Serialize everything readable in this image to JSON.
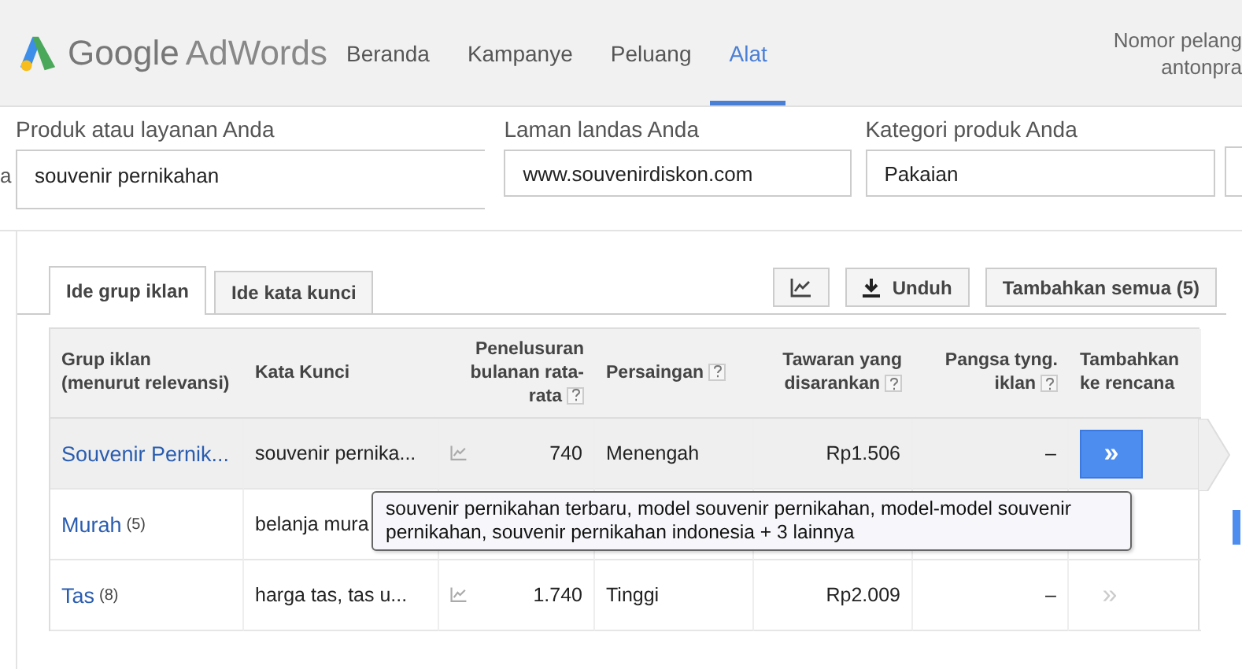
{
  "header": {
    "logo": {
      "brand": "Google",
      "product": "AdWords"
    },
    "nav": [
      {
        "label": "Beranda",
        "selected": false
      },
      {
        "label": "Kampanye",
        "selected": false
      },
      {
        "label": "Peluang",
        "selected": false
      },
      {
        "label": "Alat",
        "selected": true
      }
    ],
    "account": {
      "line_1": "Nomor pelang",
      "line_2": "antonpra"
    }
  },
  "form": {
    "left_fragment": "a",
    "fields": [
      {
        "label": "Produk atau layanan Anda",
        "value": "souvenir pernikahan"
      },
      {
        "label": "Laman landas Anda",
        "value": "www.souvenirdiskon.com"
      },
      {
        "label": "Kategori produk Anda",
        "value": "Pakaian"
      }
    ]
  },
  "tabs": [
    {
      "label": "Ide grup iklan",
      "selected": true
    },
    {
      "label": "Ide kata kunci",
      "selected": false
    }
  ],
  "toolbar": {
    "download": "Unduh",
    "add_all": "Tambahkan semua (5)"
  },
  "table": {
    "columns": [
      {
        "label": "Grup iklan (menurut relevansi)",
        "help": false
      },
      {
        "label": "Kata Kunci",
        "help": false
      },
      {
        "label": "Penelusuran bulanan rata-rata",
        "help": true
      },
      {
        "label": "Persaingan",
        "help": true
      },
      {
        "label": "Tawaran yang disarankan",
        "help": true
      },
      {
        "label": "Pangsa tyng. iklan",
        "help": true
      },
      {
        "label": "Tambahkan ke rencana",
        "help": false
      }
    ],
    "rows": [
      {
        "group": "Souvenir Pernik...",
        "keywords": "souvenir pernika...",
        "trend": true,
        "searches": "740",
        "competition": "Menengah",
        "bid": "Rp1.506",
        "share": "–",
        "highlighted": true
      },
      {
        "group": "Murah",
        "count": "(5)",
        "keywords": "belanja mura",
        "trend": false,
        "searches": "",
        "competition": "",
        "bid": "",
        "share": "",
        "highlighted": false
      },
      {
        "group": "Tas",
        "count": "(8)",
        "keywords": "harga tas, tas u...",
        "trend": true,
        "searches": "1.740",
        "competition": "Tinggi",
        "bid": "Rp2.009",
        "share": "–",
        "highlighted": false
      }
    ],
    "add_label": "»",
    "tooltip": "souvenir pernikahan terbaru, model souvenir pernikahan, model-model souvenir pernikahan, souvenir pernikahan indonesia + 3 lainnya"
  }
}
